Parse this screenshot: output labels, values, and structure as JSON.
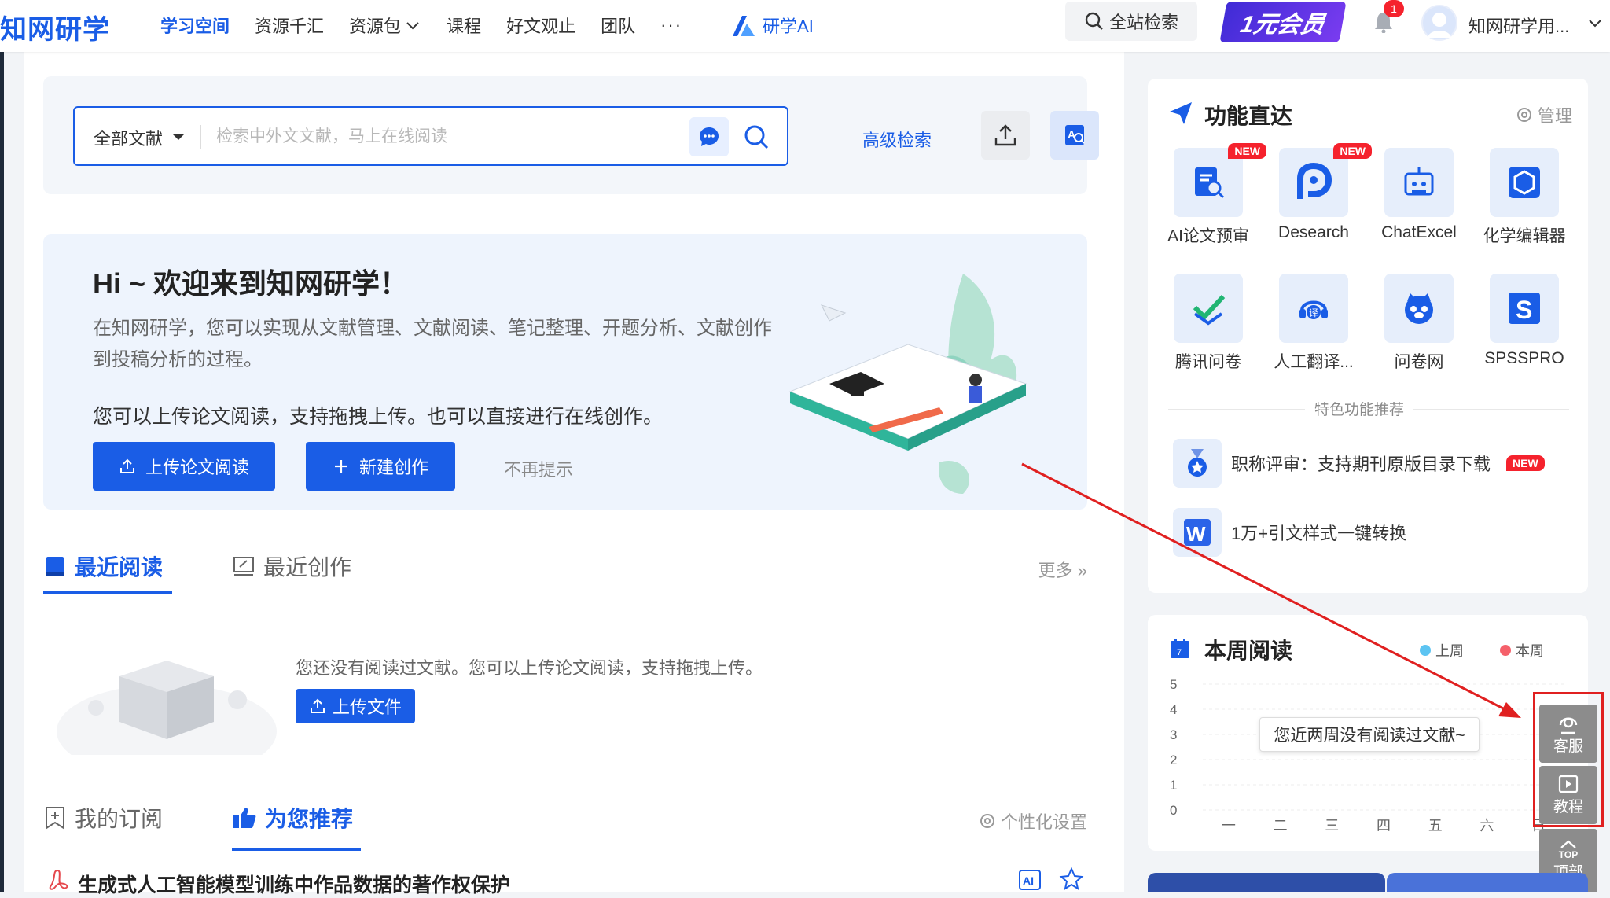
{
  "header": {
    "logo": "知网研学",
    "nav": [
      "学习空间",
      "资源千汇",
      "资源包",
      "课程",
      "好文观止",
      "团队"
    ],
    "nav_more": "···",
    "ai_label": "研学AI",
    "search_label": "全站检索",
    "vip_label": "1元会员",
    "notification_count": "1",
    "username": "知网研学用..."
  },
  "search": {
    "type_label": "全部文献",
    "placeholder": "检索中外文文献，马上在线阅读",
    "advanced": "高级检索"
  },
  "welcome": {
    "title": "Hi ~  欢迎来到知网研学！",
    "desc": "在知网研学，您可以实现从文献管理、文献阅读、笔记整理、开题分析、文献创作到投稿分析的过程。",
    "sub": "您可以上传论文阅读，支持拖拽上传。也可以直接进行在线创作。",
    "btn_upload": "上传论文阅读",
    "btn_create": "新建创作",
    "dismiss": "不再提示"
  },
  "recent": {
    "tab_read": "最近阅读",
    "tab_create": "最近创作",
    "more": "更多",
    "empty_text": "您还没有阅读过文献。您可以上传论文阅读，支持拖拽上传。",
    "upload_btn": "上传文件"
  },
  "feed": {
    "tab_sub": "我的订阅",
    "tab_rec": "为您推荐",
    "settings": "个性化设置",
    "article_title": "生成式人工智能模型训练中作品数据的著作权保护"
  },
  "features": {
    "title": "功能直达",
    "manage": "管理",
    "items": [
      {
        "label": "AI论文预审",
        "tag": "NEW"
      },
      {
        "label": "Desearch",
        "tag": "NEW"
      },
      {
        "label": "ChatExcel",
        "tag": ""
      },
      {
        "label": "化学编辑器",
        "tag": ""
      },
      {
        "label": "腾讯问卷",
        "tag": ""
      },
      {
        "label": "人工翻译...",
        "tag": ""
      },
      {
        "label": "问卷网",
        "tag": ""
      },
      {
        "label": "SPSSPRO",
        "tag": ""
      }
    ],
    "section_label": "特色功能推荐",
    "rec1": "职称评审：支持期刊原版目录下载",
    "rec1_tag": "NEW",
    "rec2": "1万+引文样式一键转换"
  },
  "week": {
    "title": "本周阅读",
    "legend_last": "上周",
    "legend_this": "本周",
    "tooltip": "您近两周没有阅读过文献~"
  },
  "chart_data": {
    "type": "line",
    "title": "本周阅读",
    "categories": [
      "一",
      "二",
      "三",
      "四",
      "五",
      "六",
      "日"
    ],
    "y_ticks": [
      "5",
      "4",
      "3",
      "2",
      "1",
      "0"
    ],
    "ylim": [
      0,
      5
    ],
    "series": [
      {
        "name": "上周",
        "values": [
          0,
          0,
          0,
          0,
          0,
          0,
          0
        ],
        "color": "#5cc4f2"
      },
      {
        "name": "本周",
        "values": [
          0,
          0,
          0,
          0,
          0,
          0,
          0
        ],
        "color": "#f5606a"
      }
    ]
  },
  "float": {
    "service": "客服",
    "tutorial": "教程",
    "top": "顶部",
    "top_en": "TOP"
  },
  "colors": {
    "brand": "#1a5de6",
    "new_tag": "#f5222d",
    "highlight_box": "#e02020"
  }
}
